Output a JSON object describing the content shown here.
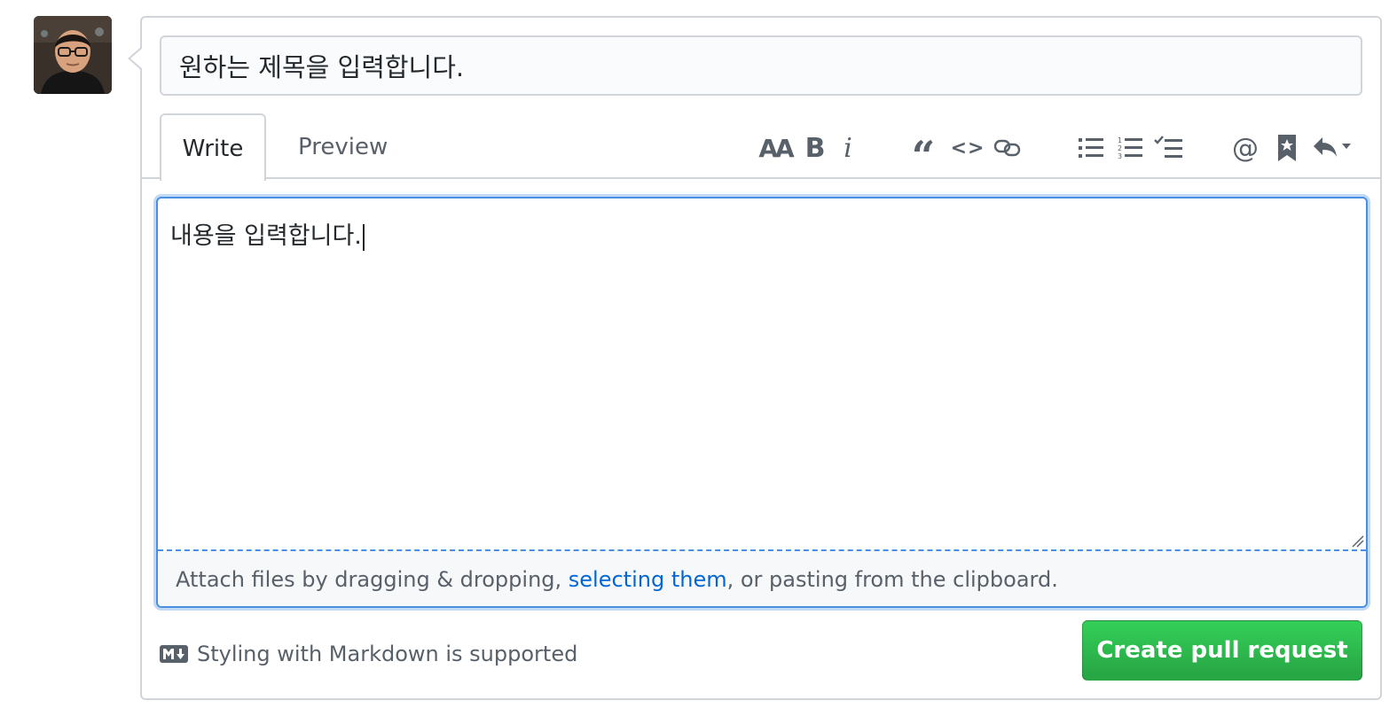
{
  "pr_form": {
    "title_value": "원하는 제목을 입력합니다.",
    "tabs": {
      "write": "Write",
      "preview": "Preview"
    },
    "toolbar": {
      "header_glyph": "AA",
      "bold_glyph": "B",
      "italic_glyph": "i",
      "quote_glyph": "“",
      "code_glyph": "<>",
      "mention_glyph": "@"
    },
    "body_value": "내용을 입력합니다.",
    "dropzone": {
      "prefix": "Attach files by dragging & dropping, ",
      "link": "selecting them",
      "suffix": ", or pasting from the clipboard."
    },
    "markdown_note": "Styling with Markdown is supported",
    "submit_label": "Create pull request"
  },
  "colors": {
    "accent_blue": "#0366d6",
    "focus_border": "#4a90e2",
    "submit_green": "#28a745",
    "muted_text": "#586069"
  }
}
